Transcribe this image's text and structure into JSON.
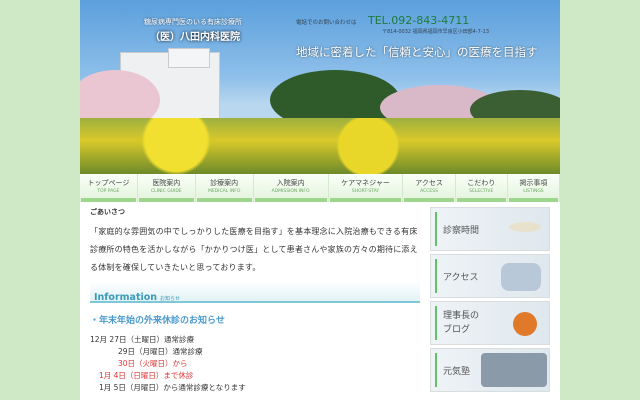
{
  "header": {
    "tagline": "糖尿病専門医のいる有床診療所",
    "clinic_name": "（医）八田内科医院",
    "contact_label": "電話でのお問い合わせは",
    "tel": "TEL.092-843-4711",
    "address": "〒814-0032 福岡県福岡市早良区小田部4-7-13",
    "slogan": "地域に密着した「信頼と安心」の医療を目指す"
  },
  "nav": [
    {
      "jp": "トップページ",
      "en": "TOP PAGE"
    },
    {
      "jp": "医院案内",
      "en": "CLINIC GUIDE"
    },
    {
      "jp": "診療案内",
      "en": "MEDICAL INFO"
    },
    {
      "jp": "入院案内",
      "en": "ADMISSION INFO"
    },
    {
      "jp": "ケアマネジャー",
      "en": "SHORT-STAY"
    },
    {
      "jp": "アクセス",
      "en": "ACCESS"
    },
    {
      "jp": "こだわり",
      "en": "SELECTIVE"
    },
    {
      "jp": "掲示事項",
      "en": "LISTINGS"
    }
  ],
  "main": {
    "greeting_heading": "ごあいさつ",
    "greeting_text": "「家庭的な雰囲気の中でしっかりした医療を目指す」を基本理念に入院治療もできる有床診療所の特色を活かしながら「かかりつけ医」として患者さんや家族の方々の期待に添える体制を確保していきたいと思っております。",
    "info_title": "Information",
    "info_sub": "お知らせ",
    "news_title": "・年末年始の外来休診のお知らせ",
    "schedule": [
      "12月 27日（土曜日）通常診療",
      "29日（月曜日）通常診療",
      "30日（火曜日）から",
      "1月 4日（日曜日）まで休診",
      "1月 5日（月曜日）から通常診療となります"
    ]
  },
  "side": [
    "診察時間",
    "アクセス",
    "理事長のブログ",
    "元気塾"
  ]
}
